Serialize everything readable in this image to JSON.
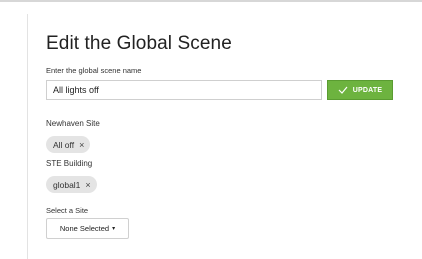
{
  "title": "Edit the Global Scene",
  "scene_name": {
    "label": "Enter the global scene name",
    "value": "All lights off"
  },
  "update_button": {
    "label": "UPDATE",
    "icon": "check-icon",
    "color": "#6db33f"
  },
  "sites": [
    {
      "label": "Newhaven Site",
      "chip": "All off",
      "remove": "×"
    },
    {
      "label": "STE Building",
      "chip": "global1",
      "remove": "×"
    }
  ],
  "site_select": {
    "label": "Select a Site",
    "selected": "None Selected",
    "caret": "▾"
  }
}
